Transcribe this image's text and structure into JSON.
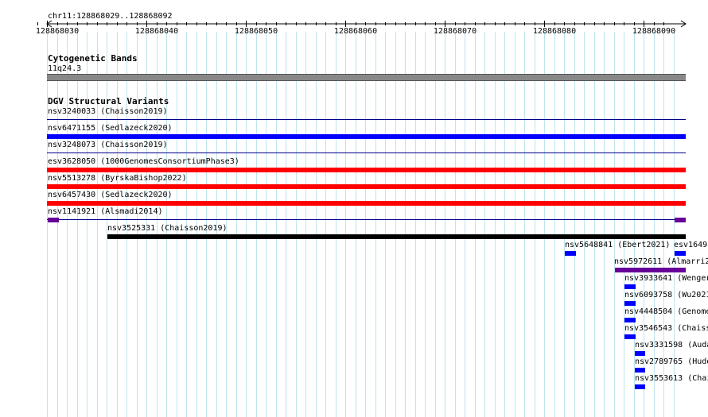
{
  "ruler": {
    "location_label": "chr11:128868029..128868092",
    "ticks": [
      {
        "pos": 128868030,
        "label": "128868030"
      },
      {
        "pos": 128868040,
        "label": "128868040"
      },
      {
        "pos": 128868050,
        "label": "128868050"
      },
      {
        "pos": 128868060,
        "label": "128868060"
      },
      {
        "pos": 128868070,
        "label": "128868070"
      },
      {
        "pos": 128868080,
        "label": "128868080"
      },
      {
        "pos": 128868090,
        "label": "128868090"
      }
    ]
  },
  "cytoband_track": {
    "title": "Cytogenetic Bands",
    "band_label": "11q24.3",
    "band_color": "#888888"
  },
  "dgv_track": {
    "title": "DGV Structural Variants",
    "colors": {
      "loss": "#ff0000",
      "gain": "#0000ff",
      "complex": "#660099",
      "inversion": "#000000",
      "thin": "#00008b"
    },
    "features": [
      {
        "label": "nsv3240033 (Chaisson2019)",
        "type": "thin"
      },
      {
        "label": "nsv6471155 (Sedlazeck2020)",
        "type": "gain"
      },
      {
        "label": "nsv3248073 (Chaisson2019)",
        "type": "thin"
      },
      {
        "label": "esv3628050 (1000GenomesConsortiumPhase3)",
        "type": "loss"
      },
      {
        "label": "nsv5513278 (ByrskaBishop2022)",
        "type": "loss"
      },
      {
        "label": "nsv6457430 (Sedlazeck2020)",
        "type": "loss"
      },
      {
        "label": "nsv1141921 (Alsmadi2014)",
        "type": "complex-ends"
      },
      {
        "label": "nsv3525331 (Chaisson2019)",
        "type": "inversion"
      },
      {
        "label": "nsv5648841 (Ebert2021)",
        "type": "gain"
      },
      {
        "label": "esv1649",
        "type": "gain"
      },
      {
        "label": "nsv5972611 (Almarri2",
        "type": "complex"
      },
      {
        "label": "nsv3933641 (Wenger",
        "type": "gain"
      },
      {
        "label": "nsv6093758 (Wu2021",
        "type": "gain"
      },
      {
        "label": "nsv4448504 (Genome",
        "type": "gain"
      },
      {
        "label": "nsv3546543 (Chaiss",
        "type": "gain"
      },
      {
        "label": "nsv3331598 (Auda",
        "type": "gain"
      },
      {
        "label": "nsv2789765 (Hudo",
        "type": "gain"
      },
      {
        "label": "nsv3553613 (Chai",
        "type": "gain"
      }
    ]
  }
}
